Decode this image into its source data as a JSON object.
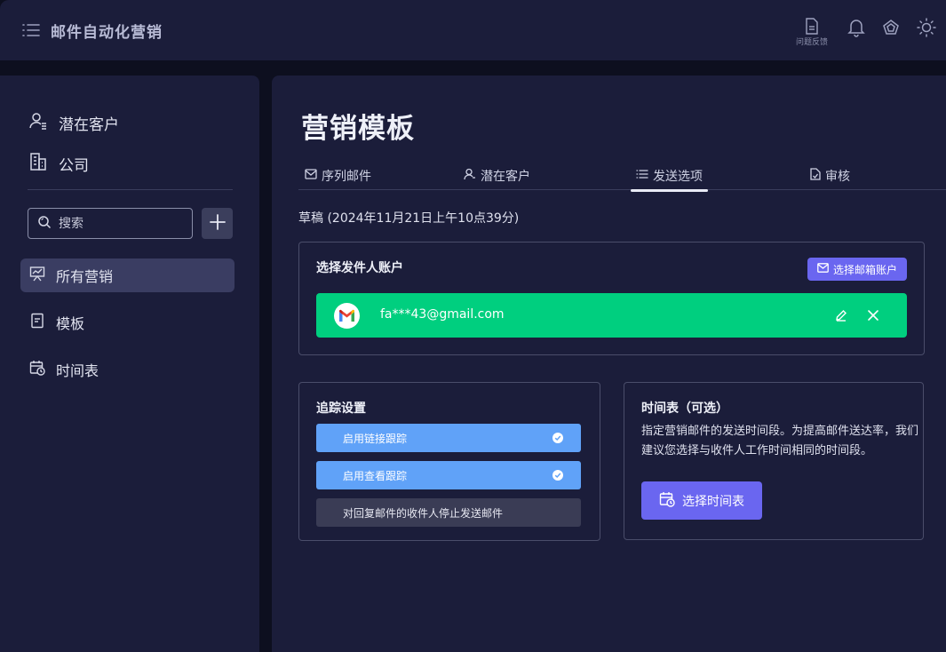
{
  "app": {
    "title": "邮件自动化营销"
  },
  "header": {
    "feedback_label": "问题反馈"
  },
  "sidebar": {
    "top_links": [
      {
        "label": "潜在客户",
        "icon": "user-list-icon"
      },
      {
        "label": "公司",
        "icon": "building-icon"
      }
    ],
    "search": {
      "placeholder": "搜索"
    },
    "nav": [
      {
        "label": "所有营销",
        "icon": "presentation-chart-icon",
        "active": true
      },
      {
        "label": "模板",
        "icon": "document-icon",
        "active": false
      },
      {
        "label": "时间表",
        "icon": "calendar-clock-icon",
        "active": false
      }
    ]
  },
  "main": {
    "title": "营销模板",
    "tabs": [
      {
        "label": "序列邮件",
        "icon": "mail-icon"
      },
      {
        "label": "潜在客户",
        "icon": "user-icon"
      },
      {
        "label": "发送选项",
        "icon": "list-icon",
        "active": true
      },
      {
        "label": "审核",
        "icon": "file-check-icon"
      }
    ],
    "draft_status": "草稿 (2024年11月21日上午10点39分)",
    "sender": {
      "title": "选择发件人账户",
      "choose_button": "选择邮箱账户",
      "email": "fa***43@gmail.com"
    },
    "tracking": {
      "title": "追踪设置",
      "options": [
        {
          "label": "启用链接跟踪",
          "checked": true
        },
        {
          "label": "启用查看跟踪",
          "checked": true
        },
        {
          "label": "对回复邮件的收件人停止发送邮件",
          "checked": false
        }
      ]
    },
    "schedule": {
      "title": "时间表（可选）",
      "description": "指定营销邮件的发送时间段。为提高邮件送达率，我们建议您选择与收件人工作时间相同的时间段。",
      "button": "选择时间表"
    }
  },
  "colors": {
    "background": "#0d0f1f",
    "panel": "#1b1d3a",
    "accent": "#6a66f0",
    "success": "#00cf7f",
    "toggle_on": "#60a2f8"
  }
}
